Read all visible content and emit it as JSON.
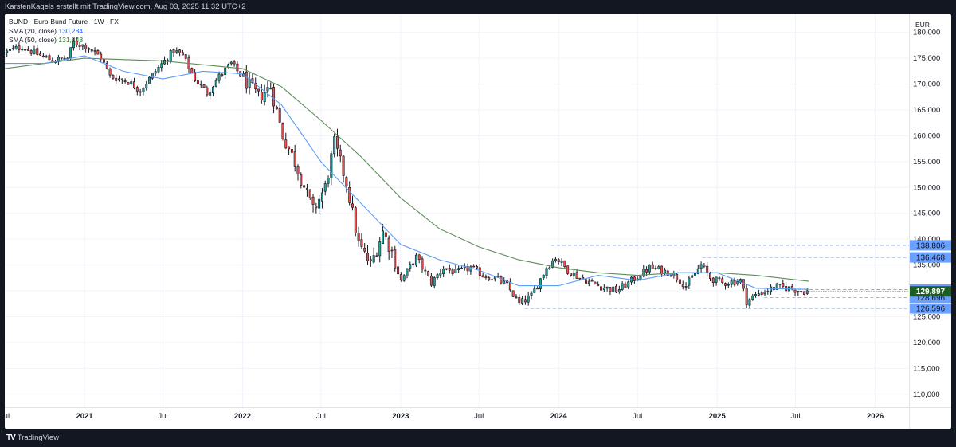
{
  "header": {
    "caption": "KarstenKagels erstellt mit TradingView.com, Aug 03, 2025 11:32 UTC+2"
  },
  "legend": {
    "symbol": "BUND · Euro-Bund Future · 1W · FX",
    "sma20_label": "SMA (20, close)",
    "sma20_value": "130,284",
    "sma50_label": "SMA (50, close)",
    "sma50_value": "131,848"
  },
  "currency": "EUR",
  "footer": {
    "brand": "TradingView",
    "logo": "TV"
  },
  "colors": {
    "up": "#26a69a",
    "down": "#ef5350",
    "sma20": "#5b9cf6",
    "sma50": "#5e8c5a",
    "price_badge": "#1b5e20",
    "level_badge": "#6aa0ff"
  },
  "chart_data": {
    "type": "candlestick",
    "title": "BUND - Euro-Bund Future - 1W - FX",
    "x_range": [
      "2020-07-01",
      "2026-03-20"
    ],
    "ylim": [
      107.5,
      183.5
    ],
    "y_ticks": [
      110,
      115,
      120,
      125,
      130,
      135,
      140,
      145,
      150,
      155,
      160,
      165,
      170,
      175,
      180
    ],
    "y_tick_labels": [
      "110,000",
      "115,000",
      "120,000",
      "125,000",
      "130,000",
      "135,000",
      "140,000",
      "145,000",
      "150,000",
      "155,000",
      "160,000",
      "165,000",
      "170,000",
      "175,000",
      "180,000"
    ],
    "x_ticks": [
      {
        "date": "2020-07-01",
        "label": "Jul"
      },
      {
        "date": "2021-01-01",
        "label": "2021"
      },
      {
        "date": "2021-07-01",
        "label": "Jul"
      },
      {
        "date": "2022-01-01",
        "label": "2022"
      },
      {
        "date": "2022-07-01",
        "label": "Jul"
      },
      {
        "date": "2023-01-01",
        "label": "2023"
      },
      {
        "date": "2023-07-01",
        "label": "Jul"
      },
      {
        "date": "2024-01-01",
        "label": "2024"
      },
      {
        "date": "2024-07-01",
        "label": "Jul"
      },
      {
        "date": "2025-01-01",
        "label": "2025"
      },
      {
        "date": "2025-07-01",
        "label": "Jul"
      },
      {
        "date": "2026-01-01",
        "label": "2026"
      }
    ],
    "close_anchors": [
      [
        "2020-07-06",
        176.2
      ],
      [
        "2020-08-10",
        177.3
      ],
      [
        "2020-09-14",
        175.8
      ],
      [
        "2020-10-19",
        174.6
      ],
      [
        "2020-11-23",
        175.0
      ],
      [
        "2020-12-07",
        178.0
      ],
      [
        "2021-01-04",
        177.4
      ],
      [
        "2021-02-08",
        175.2
      ],
      [
        "2021-03-01",
        171.5
      ],
      [
        "2021-04-12",
        170.5
      ],
      [
        "2021-05-10",
        168.8
      ],
      [
        "2021-06-14",
        172.5
      ],
      [
        "2021-07-26",
        176.5
      ],
      [
        "2021-08-16",
        175.5
      ],
      [
        "2021-09-13",
        171.0
      ],
      [
        "2021-10-11",
        168.3
      ],
      [
        "2021-11-08",
        171.5
      ],
      [
        "2021-12-06",
        174.0
      ],
      [
        "2022-01-03",
        171.0
      ],
      [
        "2022-02-07",
        167.5
      ],
      [
        "2022-03-07",
        169.5
      ],
      [
        "2022-04-04",
        160.0
      ],
      [
        "2022-05-02",
        155.0
      ],
      [
        "2022-06-13",
        145.5
      ],
      [
        "2022-07-11",
        150.0
      ],
      [
        "2022-08-01",
        158.5
      ],
      [
        "2022-08-29",
        151.0
      ],
      [
        "2022-09-26",
        139.0
      ],
      [
        "2022-10-24",
        135.0
      ],
      [
        "2022-11-21",
        141.5
      ],
      [
        "2022-12-12",
        137.5
      ],
      [
        "2023-01-02",
        132.0
      ],
      [
        "2023-02-06",
        136.5
      ],
      [
        "2023-03-13",
        131.5
      ],
      [
        "2023-04-10",
        134.5
      ],
      [
        "2023-05-08",
        133.5
      ],
      [
        "2023-06-12",
        134.5
      ],
      [
        "2023-07-10",
        133.0
      ],
      [
        "2023-08-07",
        132.5
      ],
      [
        "2023-09-04",
        131.0
      ],
      [
        "2023-10-02",
        127.5
      ],
      [
        "2023-10-30",
        129.0
      ],
      [
        "2023-12-04",
        134.5
      ],
      [
        "2023-12-25",
        136.5
      ],
      [
        "2024-01-22",
        134.0
      ],
      [
        "2024-02-19",
        132.5
      ],
      [
        "2024-04-01",
        131.0
      ],
      [
        "2024-05-13",
        130.0
      ],
      [
        "2024-06-10",
        131.5
      ],
      [
        "2024-07-29",
        134.5
      ],
      [
        "2024-09-16",
        133.5
      ],
      [
        "2024-10-21",
        131.0
      ],
      [
        "2024-11-25",
        135.0
      ],
      [
        "2024-12-16",
        132.5
      ],
      [
        "2025-01-13",
        131.5
      ],
      [
        "2025-02-24",
        132.0
      ],
      [
        "2025-03-10",
        128.0
      ],
      [
        "2025-04-07",
        129.5
      ],
      [
        "2025-05-19",
        130.8
      ],
      [
        "2025-06-16",
        130.5
      ],
      [
        "2025-07-21",
        129.9
      ],
      [
        "2025-08-01",
        129.9
      ]
    ],
    "sma20": [
      [
        "2020-07-01",
        174.0
      ],
      [
        "2020-10-01",
        174.0
      ],
      [
        "2021-01-01",
        175.5
      ],
      [
        "2021-04-01",
        172.5
      ],
      [
        "2021-07-01",
        171.0
      ],
      [
        "2021-10-01",
        172.5
      ],
      [
        "2022-01-01",
        172.0
      ],
      [
        "2022-04-01",
        166.0
      ],
      [
        "2022-07-01",
        155.0
      ],
      [
        "2022-10-01",
        147.0
      ],
      [
        "2023-01-01",
        139.0
      ],
      [
        "2023-04-01",
        136.0
      ],
      [
        "2023-07-01",
        134.0
      ],
      [
        "2023-10-01",
        131.0
      ],
      [
        "2024-01-01",
        131.0
      ],
      [
        "2024-04-01",
        133.0
      ],
      [
        "2024-07-01",
        132.0
      ],
      [
        "2024-10-01",
        133.5
      ],
      [
        "2025-01-01",
        133.5
      ],
      [
        "2025-04-01",
        130.5
      ],
      [
        "2025-08-01",
        130.284
      ]
    ],
    "sma50": [
      [
        "2020-07-01",
        173.0
      ],
      [
        "2021-01-01",
        175.0
      ],
      [
        "2021-07-01",
        174.5
      ],
      [
        "2022-01-01",
        173.0
      ],
      [
        "2022-04-01",
        169.5
      ],
      [
        "2022-07-01",
        163.0
      ],
      [
        "2022-10-01",
        156.0
      ],
      [
        "2023-01-01",
        148.0
      ],
      [
        "2023-04-01",
        142.0
      ],
      [
        "2023-07-01",
        138.5
      ],
      [
        "2023-10-01",
        136.0
      ],
      [
        "2024-01-01",
        134.5
      ],
      [
        "2024-04-01",
        133.5
      ],
      [
        "2024-07-01",
        133.0
      ],
      [
        "2024-10-01",
        133.5
      ],
      [
        "2025-01-01",
        133.5
      ],
      [
        "2025-04-01",
        133.0
      ],
      [
        "2025-08-01",
        131.848
      ]
    ],
    "horizontal_levels": [
      {
        "value": 138.806,
        "label": "138,806",
        "start": "2023-12-15"
      },
      {
        "value": 136.468,
        "label": "136,468",
        "start": "2024-11-28"
      },
      {
        "value": 130.246,
        "label": "130,246",
        "start": "2025-06-25"
      },
      {
        "value": 128.696,
        "label": "128,696",
        "start": "2025-04-20"
      },
      {
        "value": 126.596,
        "label": "126,596",
        "start": "2023-10-15"
      }
    ],
    "last_price": {
      "value": 129.897,
      "label": "129,897"
    }
  }
}
